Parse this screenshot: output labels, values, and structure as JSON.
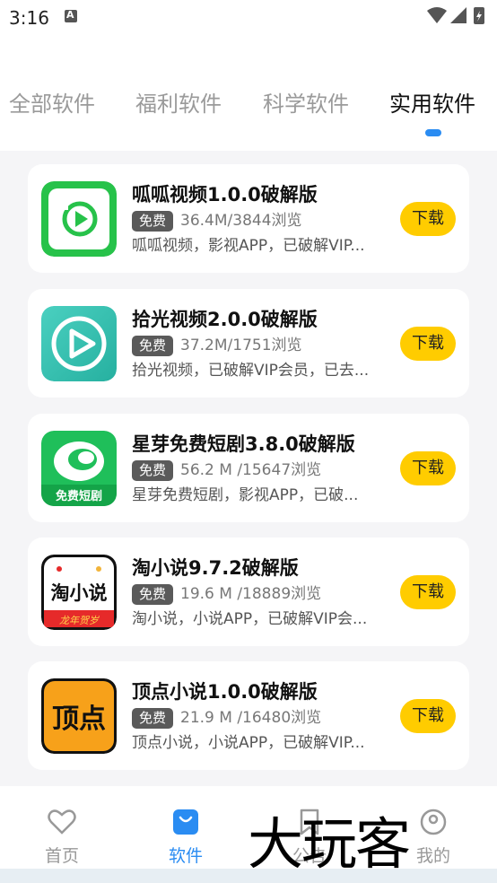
{
  "status": {
    "time": "3:16"
  },
  "tabs": [
    {
      "label": "全部软件",
      "active": false
    },
    {
      "label": "福利软件",
      "active": false
    },
    {
      "label": "科学软件",
      "active": false
    },
    {
      "label": "实用软件",
      "active": true
    }
  ],
  "apps": [
    {
      "title": "呱呱视频1.0.0破解版",
      "badge": "免费",
      "meta": "36.4M/3844浏览",
      "desc": "呱呱视频，影视APP，已破解VIP...",
      "button": "下载",
      "icon": "play-icon",
      "icon_colors": [
        "#27c24a",
        "#ffffff"
      ]
    },
    {
      "title": "拾光视频2.0.0破解版",
      "badge": "免费",
      "meta": "37.2M/1751浏览",
      "desc": "拾光视频，已破解VIP会员，已去...",
      "button": "下载",
      "icon": "play-circle-icon",
      "icon_colors": [
        "#3cc9b8",
        "#ffffff"
      ]
    },
    {
      "title": "星芽免费短剧3.8.0破解版",
      "badge": "免费",
      "meta": "56.2 M /15647浏览",
      "desc": "星芽免费短剧，影视APP，已破...",
      "button": "下载",
      "icon": "starbud-icon",
      "icon_colors": [
        "#1fbf5a",
        "#ffffff"
      ],
      "icon_text": "免费短剧"
    },
    {
      "title": "淘小说9.7.2破解版",
      "badge": "免费",
      "meta": "19.6 M /18889浏览",
      "desc": "淘小说，小说APP，已破解VIP会...",
      "button": "下载",
      "icon": "taoxiaoshuo-icon",
      "icon_colors": [
        "#e62a2a",
        "#ffffff"
      ],
      "icon_text": "淘小说",
      "icon_sub": "龙年贺岁"
    },
    {
      "title": "顶点小说1.0.0破解版",
      "badge": "免费",
      "meta": "21.9 M /16480浏览",
      "desc": "顶点小说，小说APP，已破解VIP...",
      "button": "下载",
      "icon": "dingdian-icon",
      "icon_colors": [
        "#f7a11a",
        "#111111"
      ],
      "icon_text": "顶点"
    }
  ],
  "bottom_nav": [
    {
      "label": "首页",
      "icon": "heart-icon",
      "active": false
    },
    {
      "label": "软件",
      "icon": "bag-icon",
      "active": true
    },
    {
      "label": "公告",
      "icon": "bookmark-icon",
      "active": false
    },
    {
      "label": "我的",
      "icon": "profile-icon",
      "active": false
    }
  ],
  "watermark": "大玩客",
  "colors": {
    "accent": "#2a8cf2",
    "button": "#ffcc00",
    "badge": "#5a5a5a"
  }
}
